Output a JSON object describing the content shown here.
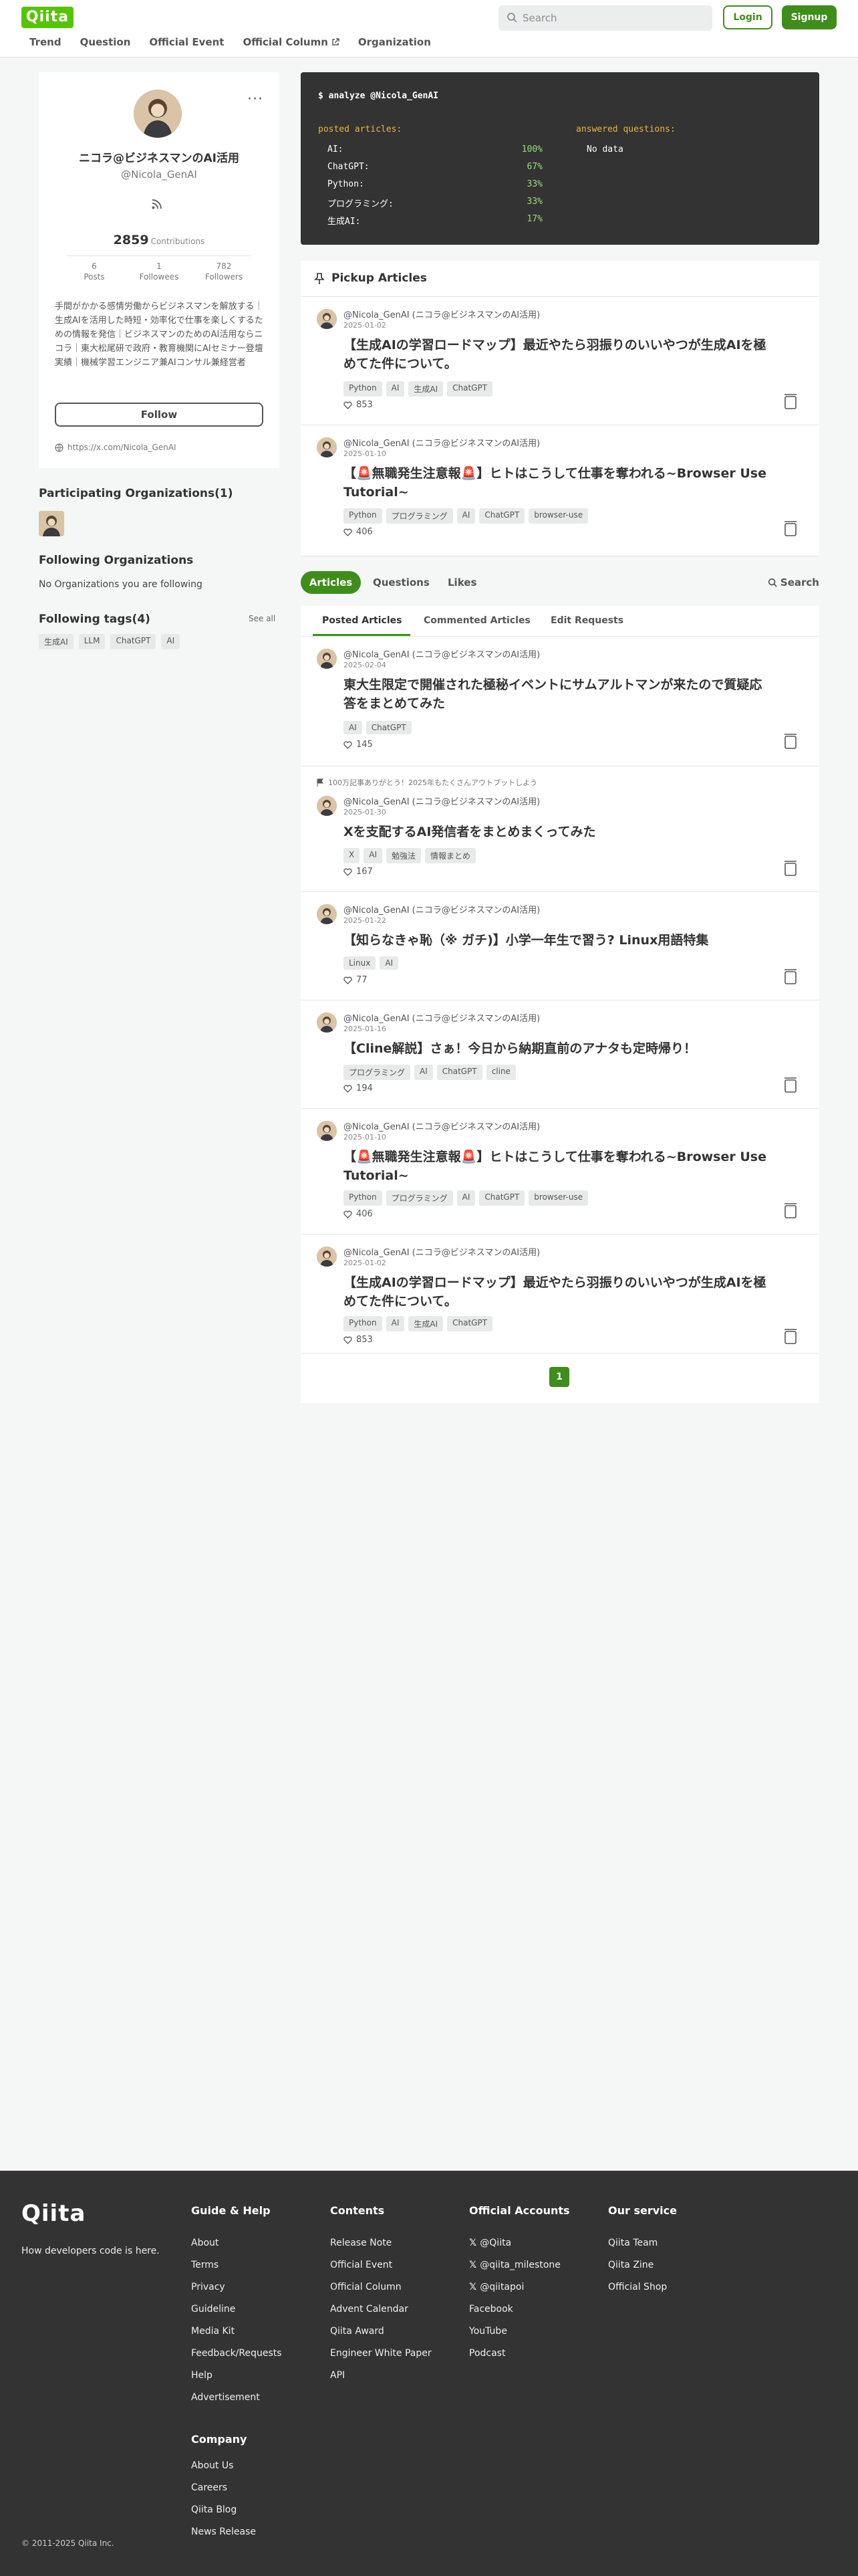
{
  "header": {
    "logo": "Qiita",
    "nav": [
      {
        "label": "Trend"
      },
      {
        "label": "Question"
      },
      {
        "label": "Official Event"
      },
      {
        "label": "Official Column",
        "external": true
      },
      {
        "label": "Organization"
      }
    ],
    "search_placeholder": "Search",
    "login_label": "Login",
    "signup_label": "Signup"
  },
  "profile": {
    "name": "ニコラ@ビジネスマンのAI活用",
    "handle": "@Nicola_GenAI",
    "contributions": "2859",
    "contributions_label": "Contributions",
    "stats": [
      {
        "value": "6",
        "label": "Posts"
      },
      {
        "value": "1",
        "label": "Followees"
      },
      {
        "value": "782",
        "label": "Followers"
      }
    ],
    "bio": "手間がかかる感情労働からビジネスマンを解放する｜生成AIを活用した時短・効率化で仕事を楽しくするための情報を発信｜ビジネスマンのためのAI活用ならニコラ｜東大松尾研で政府・教育機関にAIセミナー登壇実績｜機械学習エンジニア兼AIコンサル兼経営者",
    "follow_label": "Follow",
    "x_link": "https://x.com/Nicola_GenAI"
  },
  "sidebar": {
    "participating_title": "Participating Organizations(1)",
    "following_orgs_title": "Following Organizations",
    "no_orgs_text": "No Organizations you are following",
    "following_tags_title": "Following tags(4)",
    "see_all_label": "See all",
    "tags": [
      "生成AI",
      "LLM",
      "ChatGPT",
      "AI"
    ]
  },
  "analyze": {
    "command": "$ analyze @Nicola_GenAI",
    "posted_heading": "posted articles:",
    "answered_heading": "answered questions:",
    "rows": [
      {
        "label": "AI:",
        "pct": "100%"
      },
      {
        "label": "ChatGPT:",
        "pct": "67%"
      },
      {
        "label": "Python:",
        "pct": "33%"
      },
      {
        "label": "プログラミング:",
        "pct": "33%"
      },
      {
        "label": "生成AI:",
        "pct": "17%"
      }
    ],
    "answered_value": "No data"
  },
  "pickup": {
    "title": "Pickup Articles",
    "articles": [
      {
        "author": "@Nicola_GenAI (ニコラ@ビジネスマンのAI活用)",
        "date": "2025-01-02",
        "title": "【生成AIの学習ロードマップ】最近やたら羽振りのいいやつが生成AIを極めてた件について。",
        "tags": [
          "Python",
          "AI",
          "生成AI",
          "ChatGPT"
        ],
        "likes": "853"
      },
      {
        "author": "@Nicola_GenAI (ニコラ@ビジネスマンのAI活用)",
        "date": "2025-01-10",
        "title": "【🚨無職発生注意報🚨】ヒトはこうして仕事を奪われる~Browser Use Tutorial~",
        "tags": [
          "Python",
          "プログラミング",
          "AI",
          "ChatGPT",
          "browser-use"
        ],
        "likes": "406"
      }
    ]
  },
  "tabs": {
    "articles": "Articles",
    "questions": "Questions",
    "likes": "Likes",
    "search": "Search"
  },
  "subtabs": {
    "posted": "Posted Articles",
    "commented": "Commented Articles",
    "edit": "Edit Requests"
  },
  "articles": [
    {
      "author": "@Nicola_GenAI (ニコラ@ビジネスマンのAI活用)",
      "date": "2025-02-04",
      "title": "東大生限定で開催された極秘イベントにサムアルトマンが来たので質疑応答をまとめてみた",
      "tags": [
        "AI",
        "ChatGPT"
      ],
      "likes": "145"
    },
    {
      "banner": "100万記事ありがとう！2025年もたくさんアウトプットしよう",
      "author": "@Nicola_GenAI (ニコラ@ビジネスマンのAI活用)",
      "date": "2025-01-30",
      "title": "Xを支配するAI発信者をまとめまくってみた",
      "tags": [
        "X",
        "AI",
        "勉強法",
        "情報まとめ"
      ],
      "likes": "167"
    },
    {
      "author": "@Nicola_GenAI (ニコラ@ビジネスマンのAI活用)",
      "date": "2025-01-22",
      "title": "【知らなきゃ恥（※ ガチ)】小学一年生で習う? Linux用語特集",
      "tags": [
        "Linux",
        "AI"
      ],
      "likes": "77"
    },
    {
      "author": "@Nicola_GenAI (ニコラ@ビジネスマンのAI活用)",
      "date": "2025-01-16",
      "title": "【Cline解説】さぁ！今日から納期直前のアナタも定時帰り！",
      "tags": [
        "プログラミング",
        "AI",
        "ChatGPT",
        "cline"
      ],
      "likes": "194"
    },
    {
      "author": "@Nicola_GenAI (ニコラ@ビジネスマンのAI活用)",
      "date": "2025-01-10",
      "title": "【🚨無職発生注意報🚨】ヒトはこうして仕事を奪われる~Browser Use Tutorial~",
      "tags": [
        "Python",
        "プログラミング",
        "AI",
        "ChatGPT",
        "browser-use"
      ],
      "likes": "406"
    },
    {
      "author": "@Nicola_GenAI (ニコラ@ビジネスマンのAI活用)",
      "date": "2025-01-02",
      "title": "【生成AIの学習ロードマップ】最近やたら羽振りのいいやつが生成AIを極めてた件について。",
      "tags": [
        "Python",
        "AI",
        "生成AI",
        "ChatGPT"
      ],
      "likes": "853"
    }
  ],
  "pagination": {
    "current": "1"
  },
  "footer": {
    "logo": "Qiita",
    "tagline": "How developers code is here.",
    "copyright": "© 2011-2025 Qiita Inc.",
    "columns": [
      {
        "title": "Guide & Help",
        "items": [
          "About",
          "Terms",
          "Privacy",
          "Guideline",
          "Media Kit",
          "Feedback/Requests",
          "Help",
          "Advertisement"
        ]
      },
      {
        "title": "Contents",
        "items": [
          "Release Note",
          "Official Event",
          "Official Column",
          "Advent Calendar",
          "Qiita Award",
          "Engineer White Paper",
          "API"
        ]
      },
      {
        "title": "Official Accounts",
        "items": [
          "@Qiita",
          "@qiita_milestone",
          "@qiitapoi",
          "Facebook",
          "YouTube",
          "Podcast"
        ]
      },
      {
        "title": "Our service",
        "items": [
          "Qiita Team",
          "Qiita Zine",
          "Official Shop"
        ]
      }
    ],
    "company": {
      "title": "Company",
      "items": [
        "About Us",
        "Careers",
        "Qiita Blog",
        "News Release"
      ]
    }
  }
}
